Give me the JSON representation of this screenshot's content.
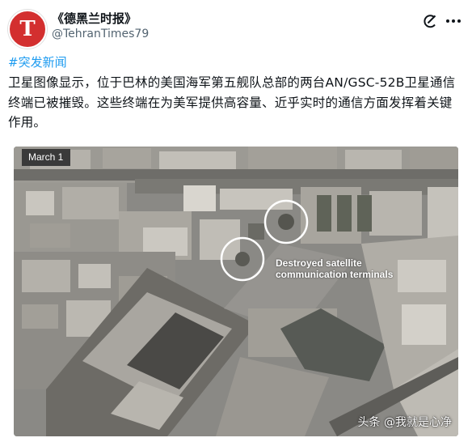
{
  "post": {
    "author_name": "《德黑兰时报》",
    "avatar_letter": "T",
    "handle": "@TehranTimes79",
    "hashtag": "#突发新闻",
    "text": "卫星图像显示，位于巴林的美国海军第五舰队总部的两台AN/GSC-52B卫星通信终端已被摧毁。这些终端在为美军提供高容量、近乎实时的通信方面发挥着关键作用。"
  },
  "image": {
    "date_label": "March 1",
    "annotation": "Destroyed satellite communication terminals",
    "watermark": "头条 @我就是心净"
  },
  "icons": {
    "top_right_1": "grok-icon",
    "top_right_2": "more-options-icon"
  },
  "colors": {
    "avatar_red": "#d32f2f",
    "link_blue": "#1d9bf0",
    "text_dark": "#0f1419",
    "text_muted": "#536471"
  }
}
